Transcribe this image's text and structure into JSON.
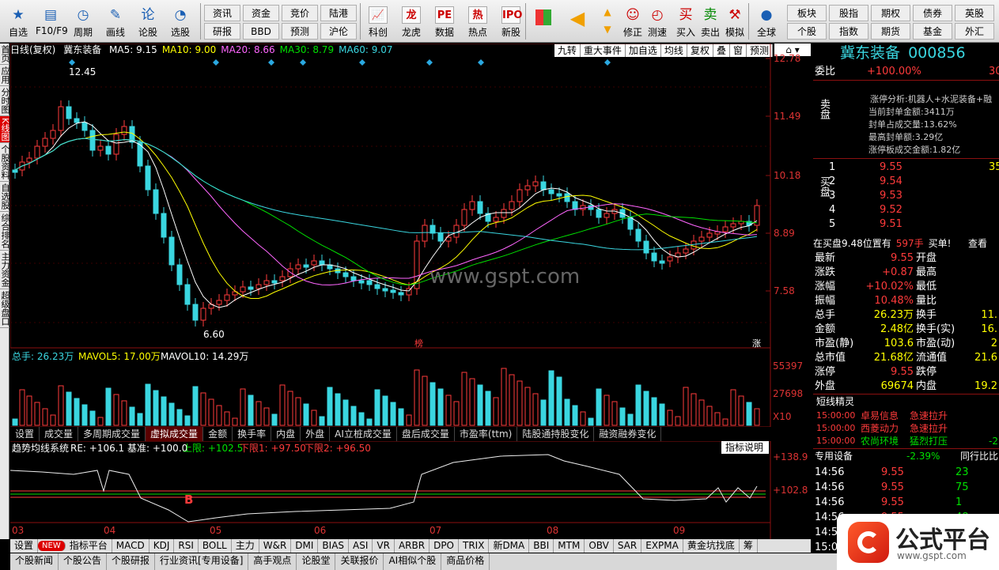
{
  "toolbar": [
    {
      "label": "自选",
      "icon": "star-icon"
    },
    {
      "label": "F10/F9",
      "icon": "f10-icon"
    },
    {
      "label": "周期",
      "icon": "clock-icon"
    },
    {
      "label": "画线",
      "icon": "pencil-icon"
    },
    {
      "label": "论股",
      "icon": "lungu-icon"
    },
    {
      "label": "选股",
      "icon": "chart-search-icon"
    }
  ],
  "toolbar_grid": [
    "资讯",
    "资金",
    "竞价",
    "陆港",
    "研报",
    "BBD",
    "预测",
    "沪伦"
  ],
  "toolbar2": [
    {
      "label": "科创",
      "icon": "chart-icon"
    },
    {
      "label": "龙虎",
      "icon": "dragon-icon"
    },
    {
      "label": "数据",
      "icon": "pe-icon"
    },
    {
      "label": "热点",
      "icon": "hot-icon"
    },
    {
      "label": "新股",
      "icon": "ipo-icon"
    }
  ],
  "toolbar3": [
    {
      "label": "修正",
      "icon": "smile-icon"
    },
    {
      "label": "测速",
      "icon": "speed-icon"
    },
    {
      "label": "买入",
      "icon": "buy-icon"
    },
    {
      "label": "卖出",
      "icon": "sell-icon"
    },
    {
      "label": "模拟",
      "icon": "hammer-icon"
    },
    {
      "label": "全球",
      "icon": "globe-icon"
    }
  ],
  "toolbar_grid2": [
    "板块",
    "股指",
    "期权",
    "债券",
    "英股",
    "个股",
    "指数",
    "期货",
    "基金",
    "外汇"
  ],
  "leftbar": [
    "首页",
    "应用",
    "分时图",
    "K线图",
    "个股资料",
    "自选股",
    "综合排名",
    "主力资金",
    "超级盘口"
  ],
  "chart": {
    "title": "日线(复权)",
    "stock": "冀东装备",
    "ma": [
      {
        "label": "MA5: 9.15",
        "color": "#ffffff"
      },
      {
        "label": "MA10: 9.00",
        "color": "#ffff00"
      },
      {
        "label": "MA20: 8.66",
        "color": "#ff66ff"
      },
      {
        "label": "MA30: 8.79",
        "color": "#00e000"
      },
      {
        "label": "MA60: 9.07",
        "color": "#3ad6e0"
      }
    ],
    "buttons": [
      "九转",
      "重大事件",
      "加自选",
      "均线",
      "复权",
      "叠",
      "窗",
      "预测"
    ],
    "price_axis": [
      "12.78",
      "11.49",
      "10.18",
      "8.89",
      "7.58"
    ],
    "high_label": "12.45",
    "low_label": "6.60",
    "watermark": "www.gspt.com",
    "marker_bang": "榜",
    "marker_zhang": "涨",
    "vol_info": [
      {
        "label": "总手: 26.23万",
        "color": "#3ad6e0"
      },
      {
        "label": "MAVOL5: 17.00万",
        "color": "#ffff00"
      },
      {
        "label": "MAVOL10: 14.29万",
        "color": "#ffffff"
      }
    ],
    "vol_axis": [
      "55397",
      "27698",
      "X10"
    ],
    "tabs": [
      "设置",
      "成交量",
      "多周期成交量",
      "虚拟成交量",
      "金额",
      "换手率",
      "内盘",
      "外盘",
      "AI立桩成交量",
      "盘后成交量",
      "市盈率(ttm)",
      "陆股通持股变化",
      "融资融券变化"
    ],
    "ind_info": {
      "name": "趋势均线系统",
      "re": "RE: +106.1",
      "base": "基准: +100.0",
      "up": "上限: +102.5",
      "dn1": "下限1: +97.50",
      "dn2": "下限2: +96.50"
    },
    "ind_btn": "指标说明",
    "ind_axis": [
      "+138.9",
      "+102.8"
    ],
    "b_marker": "B",
    "months": [
      "03",
      "04",
      "05",
      "06",
      "07",
      "08",
      "09"
    ]
  },
  "bottom_tabs": [
    "设置",
    "NEW",
    "指标平台",
    "MACD",
    "KDJ",
    "RSI",
    "BOLL",
    "主力",
    "W&R",
    "DMI",
    "BIAS",
    "ASI",
    "VR",
    "ARBR",
    "DPO",
    "TRIX",
    "新DMA",
    "BBI",
    "MTM",
    "OBV",
    "SAR",
    "EXPMA",
    "黄金坑找底",
    "筹"
  ],
  "bottom_tabs2": [
    "个股新闻",
    "个股公告",
    "个股研报",
    "行业资讯[专用设备]",
    "高手观点",
    "论股堂",
    "关联报价",
    "AI相似个股",
    "商品价格"
  ],
  "quote": {
    "name": "冀东装备",
    "code": "000856",
    "weibi_label": "委比",
    "weibi": "+100.00%",
    "weibi_r": "30",
    "sell_label": "卖盘",
    "buy_label": "买盘",
    "limit": [
      "涨停分析:机器人+水泥装备+融",
      "当前封单金额:3411万",
      "封单占成交量:13.62%",
      "最高封单额:3.29亿",
      "涨停板成交金额:1.82亿"
    ],
    "bids": [
      {
        "n": "1",
        "p": "9.55",
        "v": "35"
      },
      {
        "n": "2",
        "p": "9.54",
        "v": ""
      },
      {
        "n": "3",
        "p": "9.53",
        "v": ""
      },
      {
        "n": "4",
        "p": "9.52",
        "v": ""
      },
      {
        "n": "5",
        "p": "9.51",
        "v": ""
      }
    ],
    "zaimai": "在买盘9.48位置有",
    "zaimai_v": "597手",
    "zaimai_b": "买单!",
    "zaimai_c": "查看",
    "stats": [
      {
        "l": "最新",
        "v": "9.55",
        "l2": "开盘",
        "v2": ""
      },
      {
        "l": "涨跌",
        "v": "+0.87",
        "l2": "最高",
        "v2": ""
      },
      {
        "l": "涨幅",
        "v": "+10.02%",
        "l2": "最低",
        "v2": ""
      },
      {
        "l": "振幅",
        "v": "10.48%",
        "l2": "量比",
        "v2": ""
      },
      {
        "l": "总手",
        "v": "26.23万",
        "l2": "换手",
        "v2": "11."
      },
      {
        "l": "金额",
        "v": "2.48亿",
        "l2": "换手(实)",
        "v2": "16."
      },
      {
        "l": "市盈(静)",
        "v": "103.6",
        "l2": "市盈(动)",
        "v2": "2"
      },
      {
        "l": "总市值",
        "v": "21.68亿",
        "l2": "流通值",
        "v2": "21.6"
      },
      {
        "l": "涨停",
        "v": "9.55",
        "l2": "跌停",
        "v2": ""
      },
      {
        "l": "外盘",
        "v": "69674",
        "l2": "内盘",
        "v2": "19.2"
      }
    ],
    "jingling_title": "短线精灵",
    "jingling": [
      {
        "t": "15:00:00",
        "n": "卓易信息",
        "a": "急速拉升",
        "v": ""
      },
      {
        "t": "15:00:00",
        "n": "西菱动力",
        "a": "急速拉升",
        "v": ""
      },
      {
        "t": "15:00:00",
        "n": "农尚环境",
        "a": "猛烈打压",
        "v": "-2"
      }
    ],
    "sector": "专用设备",
    "sector_chg": "-2.39%",
    "sector_r": "同行比比",
    "ticks": [
      {
        "t": "14:56",
        "p": "9.55",
        "v": "23"
      },
      {
        "t": "14:56",
        "p": "9.55",
        "v": "75"
      },
      {
        "t": "14:56",
        "p": "9.55",
        "v": "1"
      },
      {
        "t": "14:56",
        "p": "9.55",
        "v": "48"
      },
      {
        "t": "14:5",
        "p": "",
        "v": ""
      },
      {
        "t": "15:0",
        "p": "",
        "v": ""
      }
    ]
  },
  "logo_text": "公式平台",
  "logo_url": "www.gspt.com"
}
